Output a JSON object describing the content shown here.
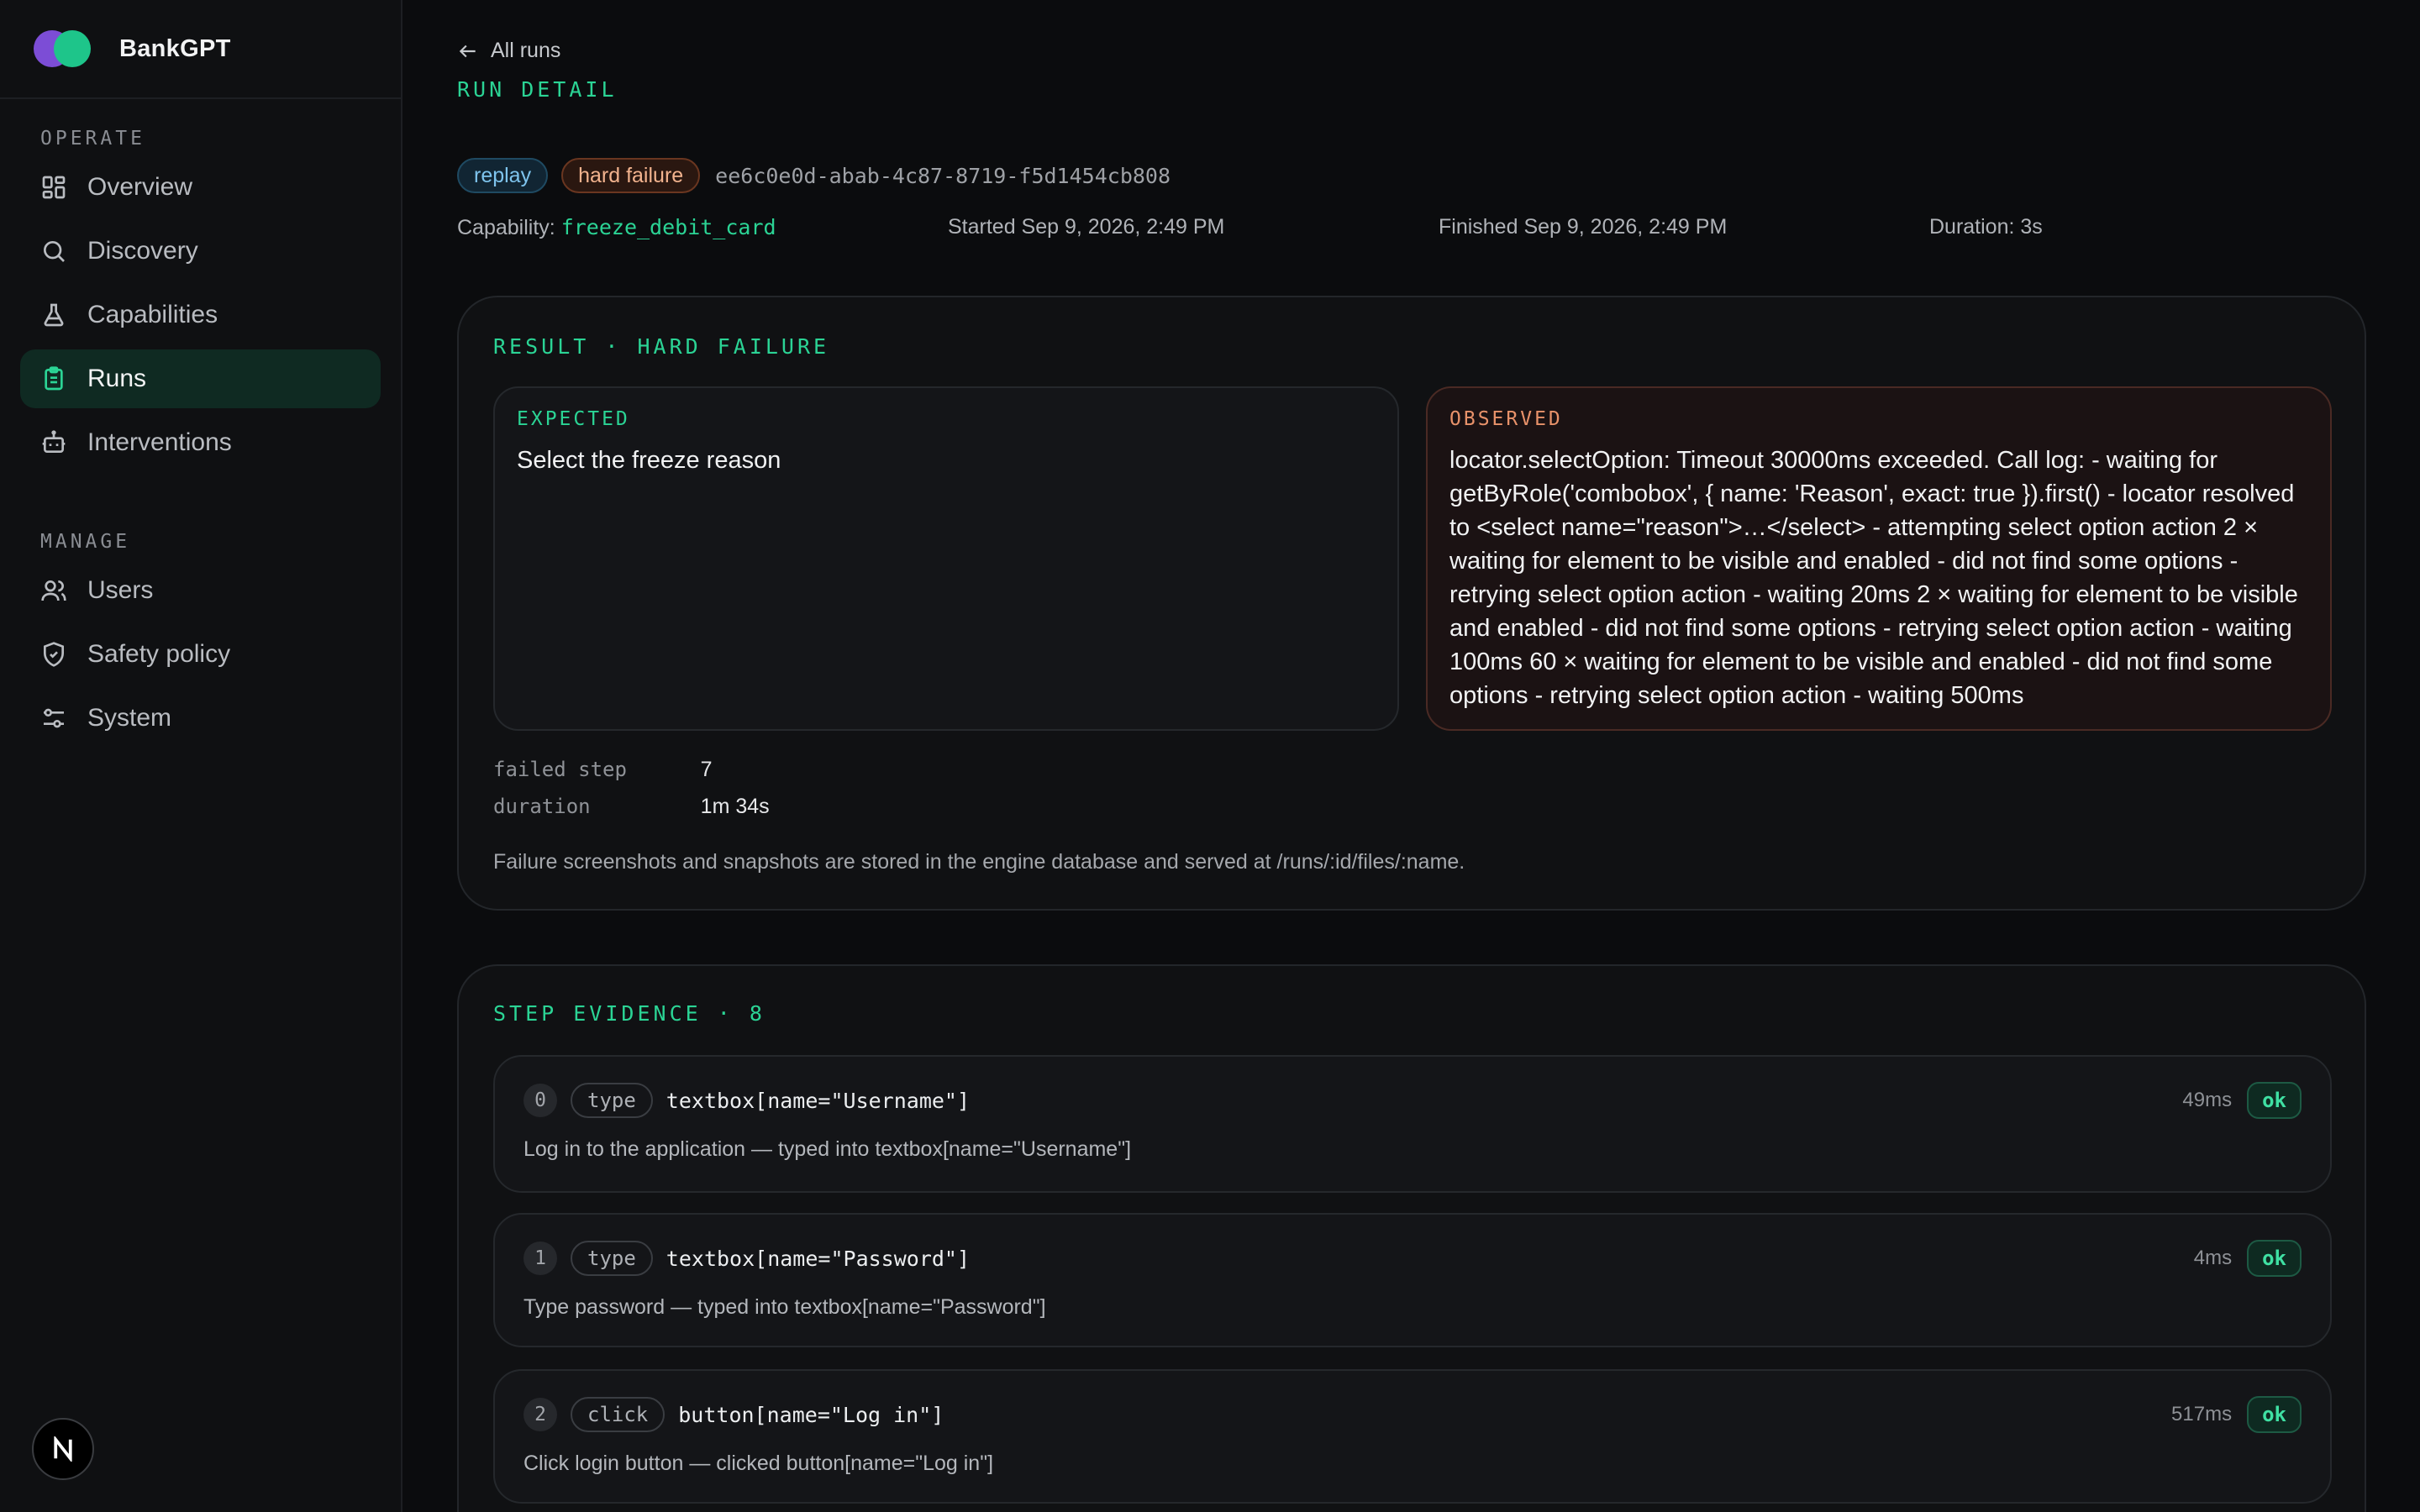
{
  "brand": {
    "name": "BankGPT"
  },
  "sidebar": {
    "sections": [
      {
        "title": "OPERATE",
        "items": [
          {
            "label": "Overview",
            "icon": "grid-icon"
          },
          {
            "label": "Discovery",
            "icon": "search-icon"
          },
          {
            "label": "Capabilities",
            "icon": "flask-icon"
          },
          {
            "label": "Runs",
            "icon": "clipboard-icon",
            "active": true
          },
          {
            "label": "Interventions",
            "icon": "robot-icon"
          }
        ]
      },
      {
        "title": "MANAGE",
        "items": [
          {
            "label": "Users",
            "icon": "users-icon"
          },
          {
            "label": "Safety policy",
            "icon": "shield-icon"
          },
          {
            "label": "System",
            "icon": "sliders-icon"
          }
        ]
      }
    ],
    "avatar_letter": "N"
  },
  "header": {
    "back_label": "All runs",
    "eyebrow": "RUN DETAIL",
    "badges": {
      "mode": "replay",
      "status": "hard failure"
    },
    "run_id": "ee6c0e0d-abab-4c87-8719-f5d1454cb808",
    "capability_label": "Capability:",
    "capability": "freeze_debit_card",
    "started": "Started Sep 9, 2026, 2:49 PM",
    "finished": "Finished Sep 9, 2026, 2:49 PM",
    "duration": "Duration: 3s"
  },
  "result": {
    "title": "RESULT · HARD FAILURE",
    "expected_label": "EXPECTED",
    "expected": "Select the freeze reason",
    "observed_label": "OBSERVED",
    "observed": "locator.selectOption: Timeout 30000ms exceeded. Call log: - waiting for getByRole('combobox', { name: 'Reason', exact: true }).first() - locator resolved to <select name=\"reason\">…</select> - attempting select option action 2 × waiting for element to be visible and enabled - did not find some options - retrying select option action - waiting 20ms 2 × waiting for element to be visible and enabled - did not find some options - retrying select option action - waiting 100ms 60 × waiting for element to be visible and enabled - did not find some options - retrying select option action - waiting 500ms",
    "failed_step_label": "failed step",
    "failed_step": "7",
    "duration_label": "duration",
    "duration": "1m 34s",
    "note": "Failure screenshots and snapshots are stored in the engine database and served at /runs/:id/files/:name."
  },
  "steps": {
    "title": "STEP EVIDENCE · 8",
    "items": [
      {
        "index": "0",
        "action": "type",
        "target": "textbox[name=\"Username\"]",
        "duration": "49ms",
        "status": "ok",
        "description": "Log in to the application — typed into textbox[name=\"Username\"]"
      },
      {
        "index": "1",
        "action": "type",
        "target": "textbox[name=\"Password\"]",
        "duration": "4ms",
        "status": "ok",
        "description": "Type password — typed into textbox[name=\"Password\"]"
      },
      {
        "index": "2",
        "action": "click",
        "target": "button[name=\"Log in\"]",
        "duration": "517ms",
        "status": "ok",
        "description": "Click login button — clicked button[name=\"Log in\"]"
      }
    ]
  }
}
